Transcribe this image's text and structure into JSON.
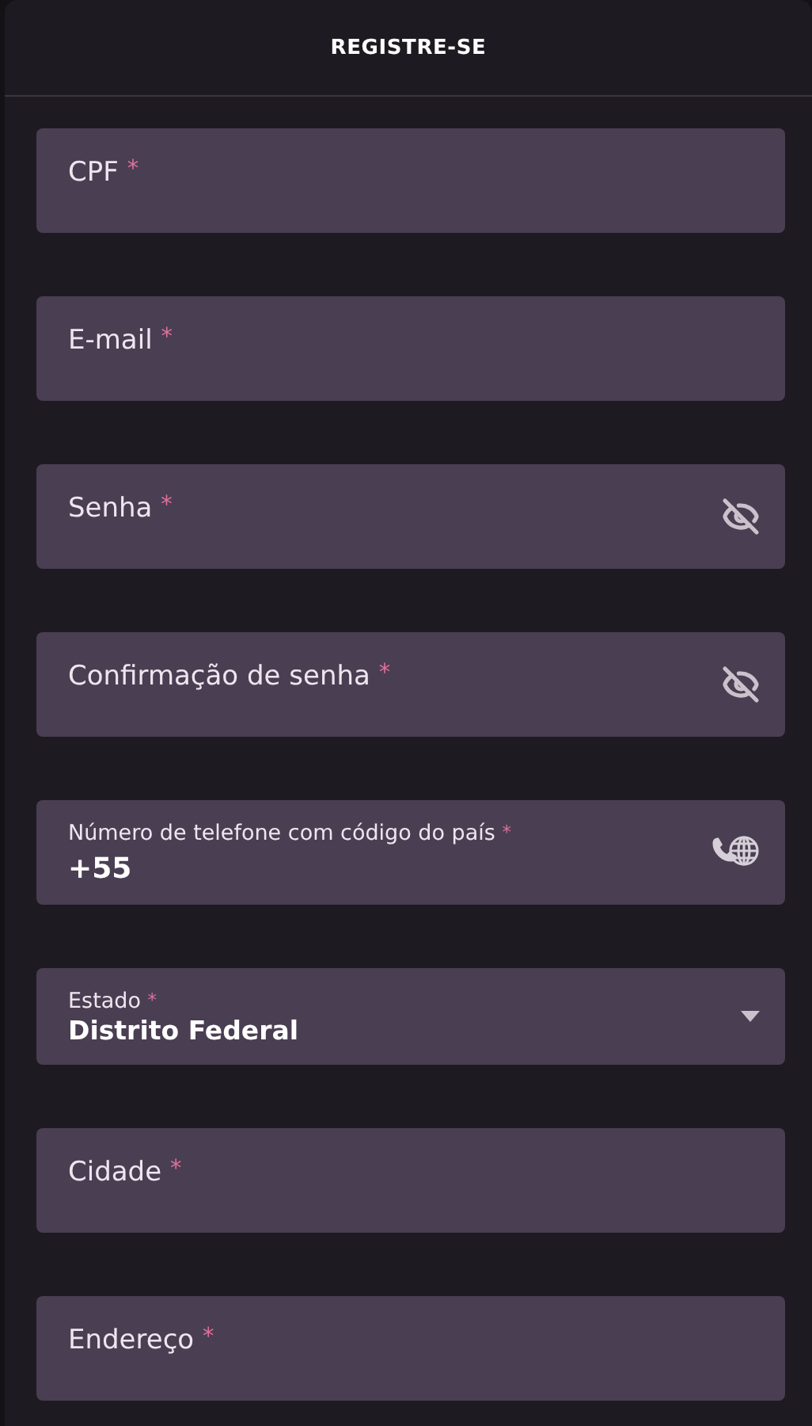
{
  "header": {
    "title": "REGISTRE-SE"
  },
  "fields": [
    {
      "kind": "text",
      "label": "CPF",
      "required_mark": "*"
    },
    {
      "kind": "text",
      "label": "E-mail",
      "required_mark": "*"
    },
    {
      "kind": "password",
      "label": "Senha",
      "required_mark": "*"
    },
    {
      "kind": "password",
      "label": "Confirmação de senha",
      "required_mark": "*"
    },
    {
      "kind": "phone",
      "label": "Número de telefone com código do país",
      "required_mark": "*",
      "value": "+55"
    },
    {
      "kind": "select",
      "label": "Estado",
      "required_mark": "*",
      "value": "Distrito Federal"
    },
    {
      "kind": "text",
      "label": "Cidade",
      "required_mark": "*"
    },
    {
      "kind": "text",
      "label": "Endereço",
      "required_mark": "*"
    }
  ]
}
